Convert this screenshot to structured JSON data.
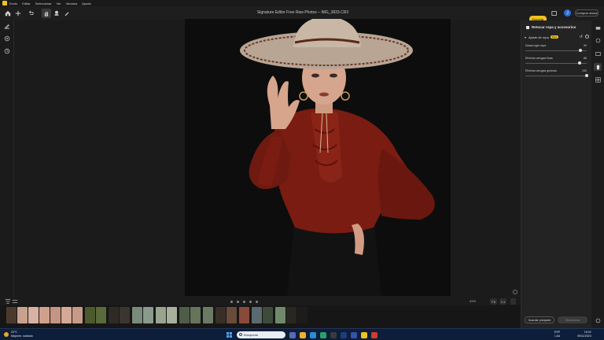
{
  "menu": {
    "items": [
      "Evoto",
      "Editar",
      "Seleccionar",
      "Ver",
      "Ventana",
      "Ayuda"
    ]
  },
  "toolbar": {
    "title": "Signature Editor Free Raw Photos – IMG_3833.CR3",
    "export_label": "Exportar",
    "buy_label": "Comprar ahora",
    "avatar_initial": "J"
  },
  "panel": {
    "title": "Retocar ropa y accesorios",
    "subpanel_title": "Ajuste de ropa",
    "subpanel_badge": "Beta",
    "sliders": [
      {
        "label": "Desarrugar ropa",
        "value": "90",
        "level": 0.9
      },
      {
        "label": "Eliminar arrugas finas",
        "value": "88",
        "level": 0.88
      },
      {
        "label": "Eliminar arrugas gruesas",
        "value": "100",
        "level": 1.0
      }
    ],
    "save_preset_label": "Guardar preajuste",
    "sync_label": "Sincronizar"
  },
  "bottom": {
    "zoom": "41%",
    "fit_label": "Fit",
    "one_to_one_label": "1:1"
  },
  "taskbar": {
    "weather_temp": "22°C",
    "weather_desc": "Mayorm. nublado",
    "search_placeholder": "Búsqueda",
    "lang_1": "ESP",
    "lang_2": "LAA",
    "time": "18:02",
    "date": "09/11/2023"
  },
  "colors": {
    "accent": "#f2c21a",
    "panel_bg": "#232324",
    "taskbar_bg": "#0c1e3a"
  }
}
